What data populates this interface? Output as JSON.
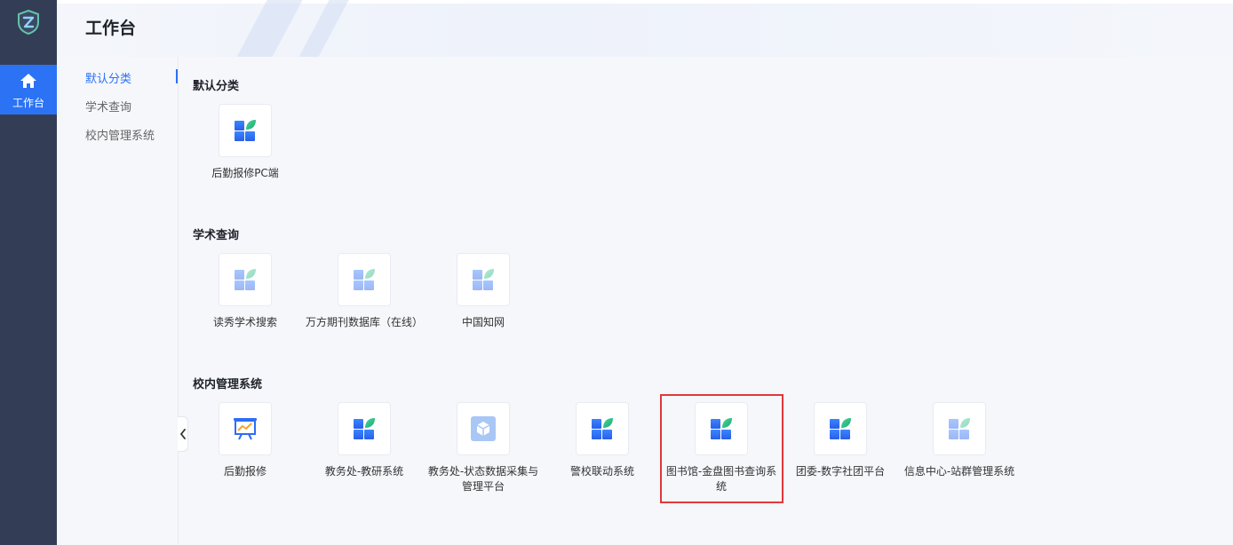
{
  "sidebar": {
    "logo_icon": "shield-z-logo",
    "nav": [
      {
        "label": "工作台",
        "icon": "home-icon",
        "active": true
      }
    ]
  },
  "header": {
    "title": "工作台"
  },
  "categories": [
    {
      "label": "默认分类",
      "active": true
    },
    {
      "label": "学术查询",
      "active": false
    },
    {
      "label": "校内管理系统",
      "active": false
    }
  ],
  "sections": [
    {
      "title": "默认分类",
      "apps": [
        {
          "name": "后勤报修PC端",
          "icon": "grid-leaf-icon"
        }
      ]
    },
    {
      "title": "学术查询",
      "apps": [
        {
          "name": "读秀学术搜索",
          "icon": "grid-leaf-faded-icon"
        },
        {
          "name": "万方期刊数据库（在线）",
          "icon": "grid-leaf-faded-icon"
        },
        {
          "name": "中国知网",
          "icon": "grid-leaf-faded-icon"
        }
      ]
    },
    {
      "title": "校内管理系统",
      "apps": [
        {
          "name": "后勤报修",
          "icon": "presentation-chart-icon"
        },
        {
          "name": "教务处-教研系统",
          "icon": "grid-leaf-icon"
        },
        {
          "name": "教务处-状态数据采集与管理平台",
          "icon": "cube-icon"
        },
        {
          "name": "警校联动系统",
          "icon": "grid-leaf-icon"
        },
        {
          "name": "图书馆-金盘图书查询系统",
          "icon": "grid-leaf-icon",
          "highlighted": true
        },
        {
          "name": "团委-数字社团平台",
          "icon": "grid-leaf-icon"
        },
        {
          "name": "信息中心-站群管理系统",
          "icon": "grid-leaf-faded-icon"
        }
      ]
    }
  ],
  "colors": {
    "sidebar_bg": "#333e56",
    "accent": "#2b72f5",
    "highlight_border": "#e0383b",
    "icon_blue": "#2f6df6",
    "icon_green": "#22c08a"
  }
}
